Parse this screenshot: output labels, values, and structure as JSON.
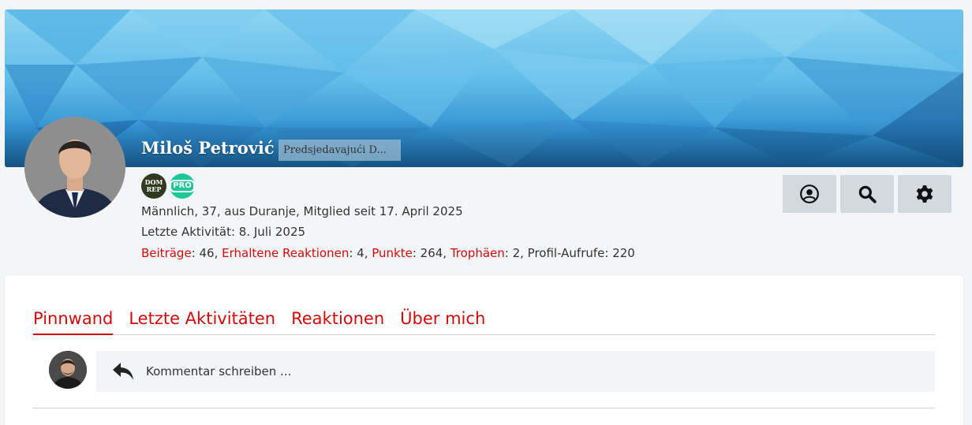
{
  "profile": {
    "name": "Miloš Petrović",
    "title": "Predsjedavajući D...",
    "badges": [
      {
        "label_top": "DOM",
        "label_bottom": "REP",
        "color": "#2f3a1f"
      },
      {
        "label": "PRO",
        "color": "#1ec79a"
      }
    ],
    "about_line": "Männlich, 37, aus Duranje, Mitglied seit 17. April 2025",
    "last_activity": "Letzte Aktivität: 8. Juli 2025",
    "stats": {
      "posts_label": "Beiträge",
      "posts_value": ": 46, ",
      "reactions_label": "Erhaltene Reaktionen",
      "reactions_value": ": 4, ",
      "points_label": "Punkte",
      "points_value": ": 264, ",
      "trophies_label": "Trophäen",
      "trophies_value": ": 2, ",
      "views_text": "Profil-Aufrufe: 220"
    }
  },
  "actions": {
    "profile_icon": "user-circle-icon",
    "search_icon": "search-icon",
    "settings_icon": "gear-icon"
  },
  "tabs": [
    {
      "label": "Pinnwand",
      "active": true
    },
    {
      "label": "Letzte Aktivitäten",
      "active": false
    },
    {
      "label": "Reaktionen",
      "active": false
    },
    {
      "label": "Über mich",
      "active": false
    }
  ],
  "comment": {
    "placeholder": "Kommentar schreiben ...",
    "icon": "reply-icon"
  },
  "colors": {
    "accent": "#d20a0a",
    "button_bg": "#d2d9df",
    "comment_bg": "#f3f4f8"
  }
}
